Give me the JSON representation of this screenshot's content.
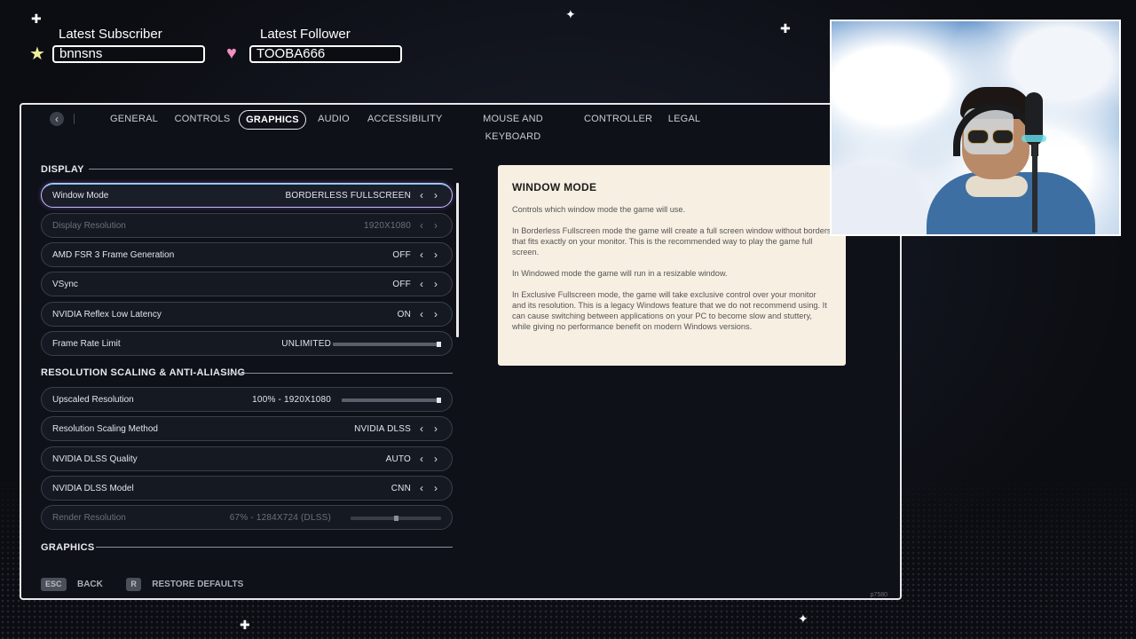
{
  "overlay": {
    "subscriber_label": "Latest Subscriber",
    "subscriber_name": "bnnsns",
    "follower_label": "Latest Follower",
    "follower_name": "TOOBA666",
    "subscriber_icon": "star-icon",
    "follower_icon": "heart-icon"
  },
  "nav": {
    "back_icon": "chevron-left-icon",
    "tabs": [
      {
        "label": "GENERAL",
        "active": false
      },
      {
        "label": "CONTROLS",
        "active": false
      },
      {
        "label": "GRAPHICS",
        "active": true
      },
      {
        "label": "AUDIO",
        "active": false
      },
      {
        "label": "ACCESSIBILITY",
        "active": false
      },
      {
        "label": "MOUSE AND KEYBOARD",
        "active": false
      },
      {
        "label": "CONTROLLER",
        "active": false
      },
      {
        "label": "LEGAL",
        "active": false
      }
    ]
  },
  "sections": {
    "display": "DISPLAY",
    "resolution": "RESOLUTION SCALING & ANTI-ALIASING",
    "graphics": "GRAPHICS"
  },
  "display_rows": [
    {
      "label": "Window Mode",
      "value": "BORDERLESS FULLSCREEN",
      "selected": true,
      "dim": false
    },
    {
      "label": "Display Resolution",
      "value": "1920X1080",
      "selected": false,
      "dim": true
    },
    {
      "label": "AMD FSR 3 Frame Generation",
      "value": "OFF",
      "selected": false,
      "dim": false
    },
    {
      "label": "VSync",
      "value": "OFF",
      "selected": false,
      "dim": false
    },
    {
      "label": "NVIDIA Reflex Low Latency",
      "value": "ON",
      "selected": false,
      "dim": false
    },
    {
      "label": "Frame Rate Limit",
      "value": "UNLIMITED",
      "slider_fraction": 1.0,
      "selected": false,
      "dim": false
    }
  ],
  "resolution_rows": [
    {
      "label": "Upscaled Resolution",
      "value": "100% - 1920X1080",
      "slider_fraction": 1.0,
      "dim": false
    },
    {
      "label": "Resolution Scaling Method",
      "value": "NVIDIA DLSS",
      "dim": false
    },
    {
      "label": "NVIDIA DLSS Quality",
      "value": "AUTO",
      "dim": false
    },
    {
      "label": "NVIDIA DLSS Model",
      "value": "CNN",
      "dim": false
    },
    {
      "label": "Render Resolution",
      "value": "67% - 1284X724 (DLSS)",
      "slider_fraction": 0.5,
      "dim": true
    }
  ],
  "info": {
    "title": "WINDOW MODE",
    "paragraphs": [
      "Controls which window mode the game will use.",
      "In Borderless Fullscreen mode the game will create a full screen window without borders that fits exactly on your monitor. This is the recommended way to play the game full screen.",
      "In Windowed mode the game will run in a resizable window.",
      "In Exclusive Fullscreen mode, the game will take exclusive control over your monitor and its resolution. This is a legacy Windows feature that we do not recommend using. It can cause switching between applications on your PC to become slow and stuttery, while giving no performance benefit on modern Windows versions."
    ]
  },
  "footer": {
    "back_key": "ESC",
    "back_label": "BACK",
    "restore_key": "R",
    "restore_label": "RESTORE DEFAULTS",
    "build_id": "p7580"
  },
  "colors": {
    "accent_border": "#c9b9ff",
    "accent_glow": "#6fd3ff",
    "info_bg": "#f7efe2"
  }
}
